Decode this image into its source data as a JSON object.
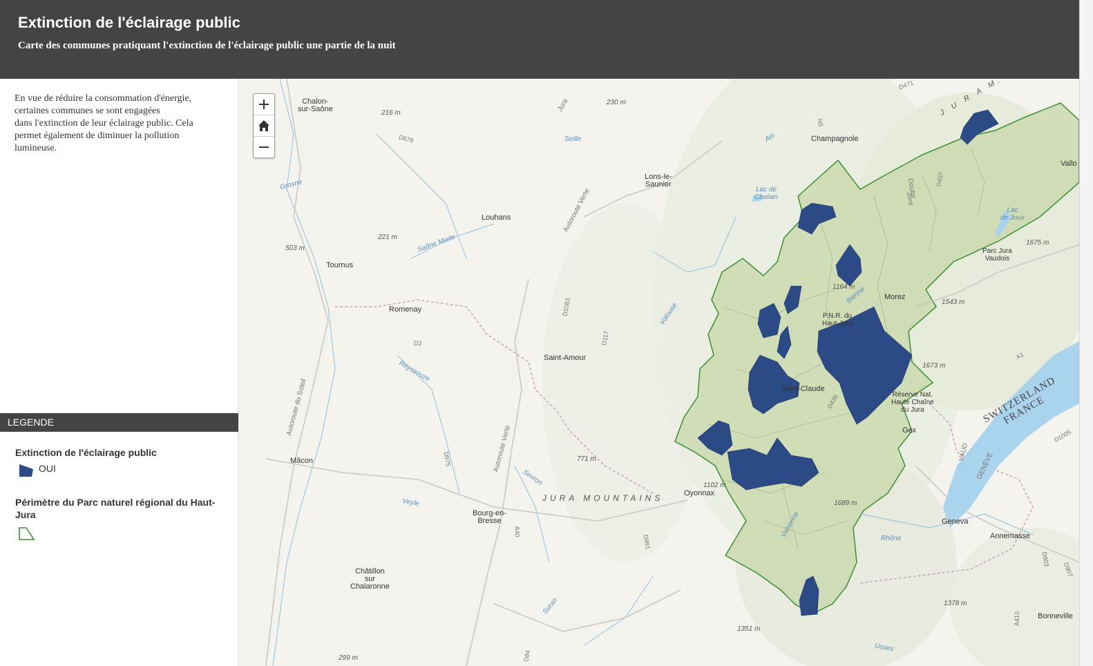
{
  "header": {
    "title": "Extinction de l'éclairage public",
    "subtitle": "Carte des communes pratiquant l'extinction de l'éclairage public une partie de la nuit"
  },
  "sidebar": {
    "intro_lines": [
      "En vue de réduire la consommation d'énergie,",
      "certaines communes se sont engagées",
      "dans l'extinction de leur éclairage public. Cela",
      "permet également de diminuer la pollution",
      "lumineuse."
    ]
  },
  "legend": {
    "header": "LEGENDE",
    "layers": [
      {
        "title": "Extinction de l'éclairage public",
        "item_label": "OUI",
        "fill_color": "#2c4a85"
      },
      {
        "title": "Périmètre du Parc naturel régional du Haut-Jura",
        "outline_color": "#3a8f30"
      }
    ]
  },
  "map": {
    "zoom_controls": [
      "zoom-in",
      "home",
      "zoom-out"
    ],
    "place_labels": {
      "chalon": "Chalon-\nsur-Saône",
      "champagnole": "Champagnole",
      "lons": "Lons-le-\nSaunier",
      "louhans": "Louhans",
      "tournus": "Tournus",
      "romenay": "Romenay",
      "saint_amour": "Saint-Amour",
      "macon": "Mâcon",
      "bourg": "Bourg-en-\nBresse",
      "chatillon": "Châtillon\nsur\nChalaronne",
      "oyonnax": "Oyonnax",
      "saint_claude": "Saint-Claude",
      "morez": "Morez",
      "pnr": "P.N.R. du\nHaut-Jura",
      "reserve": "Réserve Nat.\nHaute Chaîne\ndu Jura",
      "gex": "Gex",
      "geneva": "Geneva",
      "annemasse": "Annemasse",
      "bonneville": "Bonneville",
      "vallo": "Vallo",
      "parc_vaudois": "Parc Jura\nVaudois",
      "lac_chalain": "Lac de\nChalain",
      "lac_joux": "Lac\nde Joux"
    },
    "elevation_labels": [
      "216 m",
      "230 m",
      "221 m",
      "503 m",
      "771 m",
      "1102 m",
      "1164 m",
      "1543 m",
      "1675 m",
      "1673 m",
      "1689 m",
      "1351 m",
      "1378 m",
      "299 m"
    ],
    "water_labels": [
      "Seille",
      "Grosne",
      "Saône Morte",
      "Reyssouze",
      "Sevron",
      "Veyle",
      "Valouse",
      "Ain",
      "Rhône",
      "Bienne",
      "Valserine",
      "Suran",
      "Usses"
    ],
    "road_labels": [
      "D678",
      "D1083",
      "D117",
      "D2",
      "D975",
      "D436",
      "D991",
      "A40",
      "A1",
      "D1005",
      "D907",
      "D437",
      "N5",
      "D471",
      "D903",
      "A410",
      "D84"
    ],
    "region_labels": [
      "Jura",
      "Autoroute Verte",
      "Autoroute Verte",
      "Autoroute du Soleil",
      "Doubs",
      "Jura",
      "VAUD",
      "GENÈVE",
      "JURA MOUNTAINS",
      "SWITZERLAND",
      "FRANCE",
      "J U R A  M."
    ],
    "colors": {
      "commune_fill": "#2c4a85",
      "park_outline": "#3a8f30",
      "park_fill": "#c9d8ad",
      "lake": "#aad3ee"
    }
  }
}
